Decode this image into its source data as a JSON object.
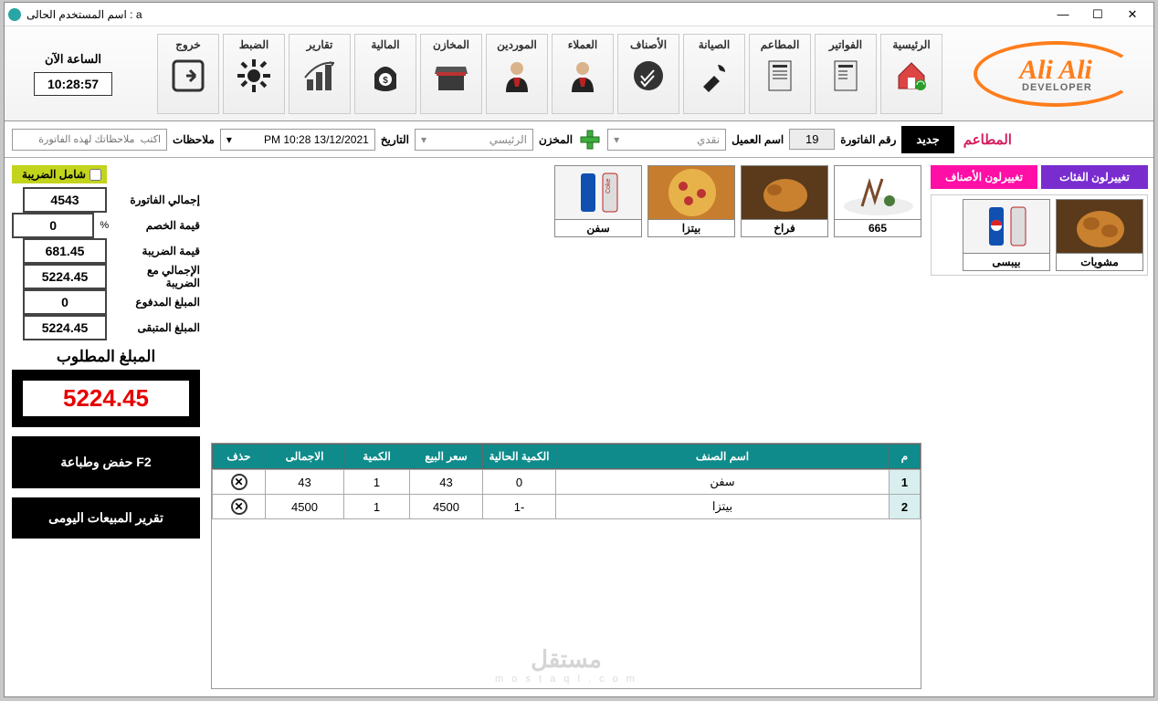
{
  "window": {
    "title": "اسم المستخدم الحالى  :  a"
  },
  "clock": {
    "label": "الساعة الآن",
    "time": "10:28:57"
  },
  "ribbon": [
    {
      "id": "exit",
      "label": "خروج"
    },
    {
      "id": "settings",
      "label": "الضبط"
    },
    {
      "id": "reports",
      "label": "تقارير"
    },
    {
      "id": "finance",
      "label": "المالية"
    },
    {
      "id": "stores",
      "label": "المخازن"
    },
    {
      "id": "suppliers",
      "label": "الموردين"
    },
    {
      "id": "customers",
      "label": "العملاء"
    },
    {
      "id": "items",
      "label": "الأصناف"
    },
    {
      "id": "maintenance",
      "label": "الصيانة"
    },
    {
      "id": "restaurants",
      "label": "المطاعم"
    },
    {
      "id": "invoices",
      "label": "الفواتير"
    },
    {
      "id": "home",
      "label": "الرئيسية"
    }
  ],
  "logo": {
    "line1": "Ali Ali",
    "line2": "DEVELOPER"
  },
  "filter": {
    "section": "المطاعم",
    "new_btn": "جديد",
    "invoice_no_lbl": "رقم الفاتورة",
    "invoice_no": "19",
    "customer_lbl": "اسم العميل",
    "customer_val": "نقدي",
    "store_lbl": "المخزن",
    "store_val": "الرئيسي",
    "date_lbl": "التاريخ",
    "date_val": "13/12/2021  10:28 PM",
    "notes_lbl": "ملاحظات",
    "notes_ph": "اكتب  ملاحظاتك لهذه الفاتورة"
  },
  "summary": {
    "tax_incl_lbl": "شامل الضريبة",
    "rows": [
      {
        "lbl": "إجمالي الفاتورة",
        "val": "4543"
      },
      {
        "lbl": "قيمة الخصم",
        "val": "0",
        "pct": "%"
      },
      {
        "lbl": "قيمة الضريبة",
        "val": "681.45"
      },
      {
        "lbl": "الإجمالي  مع الضريبة",
        "val": "5224.45"
      },
      {
        "lbl": "المبلغ المدفوع",
        "val": "0"
      },
      {
        "lbl": "المبلغ المتبقى",
        "val": "5224.45"
      }
    ],
    "required_lbl": "المبلغ المطلوب",
    "required_val": "5224.45",
    "save_btn": "حفض وطباعة  F2",
    "daily_btn": "تقرير المبيعات اليومى"
  },
  "products": [
    {
      "name": "سفن"
    },
    {
      "name": "بيتزا"
    },
    {
      "name": "فراخ"
    },
    {
      "name": "665"
    }
  ],
  "categories": [
    {
      "name": "بيبسى"
    },
    {
      "name": "مشويات"
    }
  ],
  "color_btns": {
    "items_btn": "تغييرلون الأصناف",
    "cats_btn": "تغييرلون الفئات"
  },
  "grid": {
    "headers": {
      "m": "م",
      "name": "اسم الصنف",
      "cur_qty": "الكمية الحالية",
      "price": "سعر البيع",
      "qty": "الكمية",
      "total": "الاجمالى",
      "del": "حذف"
    },
    "rows": [
      {
        "m": "1",
        "name": "سفن",
        "cur_qty": "0",
        "price": "43",
        "qty": "1",
        "total": "43"
      },
      {
        "m": "2",
        "name": "بيتزا",
        "cur_qty": "-1",
        "price": "4500",
        "qty": "1",
        "total": "4500"
      }
    ]
  },
  "watermark": {
    "l1": "مستقل",
    "l2": "m o s t a q l . c o m"
  }
}
